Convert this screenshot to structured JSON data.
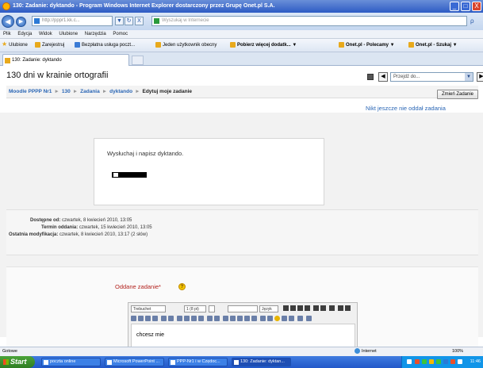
{
  "window": {
    "title": "130: Zadanie: dyktando - Program Windows Internet Explorer dostarczony przez Grupę Onet.pl S.A.",
    "minimize_glyph": "_",
    "maximize_glyph": "□",
    "close_glyph": "X"
  },
  "address_bar": {
    "back_glyph": "◀",
    "forward_glyph": "▶",
    "url": "http://pppr1.kk.c...",
    "refresh_glyph": "↻",
    "stop_glyph": "X",
    "search_placeholder": "Wyszukaj w Internecie",
    "search_go_glyph": "ρ"
  },
  "menu": [
    "Plik",
    "Edycja",
    "Widok",
    "Ulubione",
    "Narzędzia",
    "Pomoc"
  ],
  "favorites": {
    "label": "Ulubione",
    "items": [
      "Zarejestruj",
      "Bezpłatna usługa poczt...",
      "Jeden użytkownik obecny",
      "Pobierz więcej dodatk...",
      "Onet.pl - Polecamy",
      "Onet.pl - Szukaj"
    ]
  },
  "tab": {
    "title": "130: Zadanie: dyktando"
  },
  "page": {
    "course_title": "130 dni w krainie ortografii",
    "jump_placeholder": "Przejdź do...",
    "jump_prev": "◀",
    "jump_next": "▶",
    "jump_arrow": "▼",
    "breadcrumb": [
      "Moodle PPPP Nr1",
      "130",
      "Zadania",
      "dyktando",
      "Edytuj moje zadanie"
    ],
    "breadcrumb_sep": "►",
    "edit_button": "Zmień Zadanie",
    "no_submissions": "Nikt jeszcze nie oddał zadania",
    "intro_text": "Wysłuchaj i napisz dyktando.",
    "dates": {
      "available_label": "Dostępne od:",
      "available_value": "czwartek, 8 kwiecień 2010, 13:05",
      "due_label": "Termin oddania:",
      "due_value": "czwartek, 15 kwiecień 2010, 13:05",
      "modified_label": "Ostatnia modyfikacja:",
      "modified_value": "czwartek, 8 kwiecień 2010, 13:17 (2 słów)"
    },
    "submit_label": "Oddane zadanie*",
    "help_glyph": "?",
    "editor": {
      "font": "Trebuchet",
      "size": "1 (8 pt)",
      "lang": "Język",
      "content": "chcesz mie"
    }
  },
  "status": {
    "text": "Gotowe",
    "zone": "Internet",
    "zoom": "100%"
  },
  "taskbar": {
    "start": "Start",
    "tasks": [
      "poczta online",
      "Microsoft PowerPoint ...",
      "PPP-Nr1 i w Czędoc...",
      "130: Zadanie: dyktan..."
    ],
    "clock": "11:46"
  }
}
